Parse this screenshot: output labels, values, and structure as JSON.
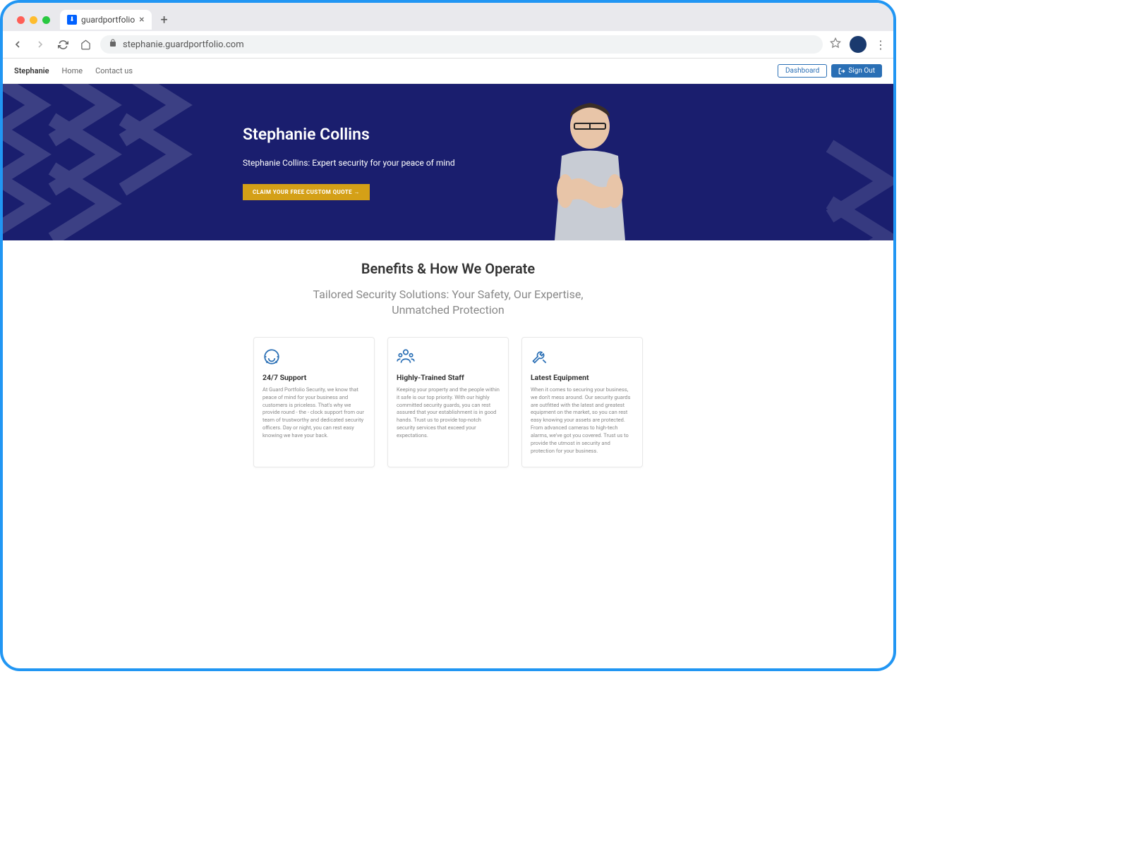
{
  "browser": {
    "tab_title": "guardportfolio",
    "url": "stephanie.guardportfolio.com"
  },
  "nav": {
    "brand": "Stephanie",
    "links": [
      "Home",
      "Contact us"
    ],
    "dashboard": "Dashboard",
    "signout": "Sign Out"
  },
  "hero": {
    "title": "Stephanie Collins",
    "subtitle": "Stephanie Collins: Expert security for your peace of mind",
    "cta": "CLAIM YOUR FREE CUSTOM QUOTE →"
  },
  "benefits": {
    "heading": "Benefits & How We Operate",
    "subheading": "Tailored Security Solutions: Your Safety, Our Expertise, Unmatched Protection",
    "cards": [
      {
        "title": "24/7 Support",
        "body": "At Guard Portfolio Security, we know that peace of mind for your business and customers is priceless. That's why we provide round - the - clock support from our team of trustworthy and dedicated security officers. Day or night, you can rest easy knowing we have your back."
      },
      {
        "title": "Highly-Trained Staff",
        "body": "Keeping your property and the people within it safe is our top priority. With our highly committed security guards, you can rest assured that your establishment is in good hands. Trust us to provide top-notch security services that exceed your expectations."
      },
      {
        "title": "Latest Equipment",
        "body": "When it comes to securing your business, we don't mess around. Our security guards are outfitted with the latest and greatest equipment on the market, so you can rest easy knowing your assets are protected. From advanced cameras to high-tech alarms, we've got you covered. Trust us to provide the utmost in security and protection for your business."
      }
    ]
  }
}
